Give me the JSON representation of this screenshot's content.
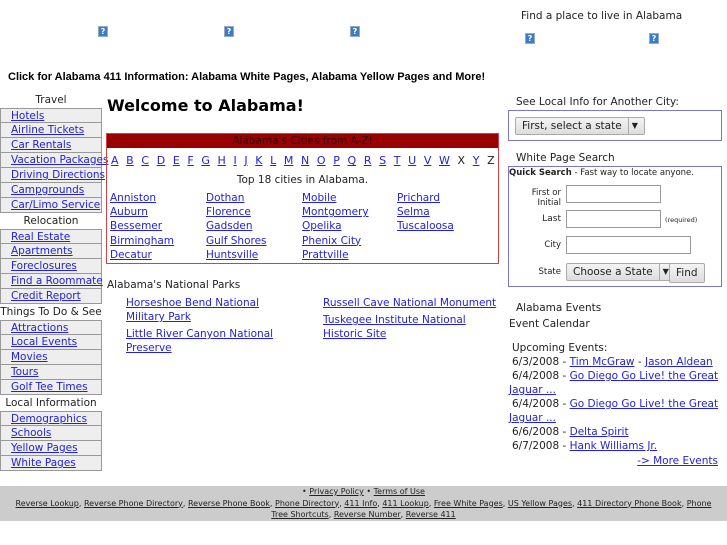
{
  "header": {
    "find_place": "Find a place to live in Alabama",
    "icon": "broken-image-icon",
    "info_line": "Click for Alabama 411 Information: Alabama White Pages, Alabama Yellow Pages and More!"
  },
  "sidebar": [
    {
      "title": "Travel",
      "items": [
        "Hotels",
        "Airline Tickets",
        "Car Rentals",
        "Vacation Packages",
        "Driving Directions",
        "Campgrounds",
        "Car/Limo Service"
      ]
    },
    {
      "title": "Relocation",
      "items": [
        "Real Estate",
        "Apartments",
        "Foreclosures",
        "Find a Roommate",
        "Credit Report"
      ]
    },
    {
      "title": "Things To Do & See",
      "items": [
        "Attractions",
        "Local Events",
        "Movies",
        "Tours",
        "Golf Tee Times"
      ]
    },
    {
      "title": "Local Information",
      "items": [
        "Demographics",
        "Schools",
        "Yellow Pages",
        "White Pages"
      ]
    }
  ],
  "main": {
    "title": "Welcome to Alabama!",
    "cities_header": "Alabama's Cities from A-Z!",
    "letters": [
      "A",
      "B",
      "C",
      "D",
      "E",
      "F",
      "G",
      "H",
      "I",
      "J",
      "K",
      "L",
      "M",
      "N",
      "O",
      "P",
      "Q",
      "R",
      "S",
      "T",
      "U",
      "V",
      "W",
      "X",
      "Y",
      "Z"
    ],
    "unlinked_letters": [
      "X",
      "Z"
    ],
    "top_cities_label": "Top 18 cities in Alabama.",
    "city_columns": [
      [
        "Anniston",
        "Auburn",
        "Bessemer",
        "Birmingham",
        "Decatur"
      ],
      [
        "Dothan",
        "Florence",
        "Gadsden",
        "Gulf Shores",
        "Huntsville"
      ],
      [
        "Mobile",
        "Montgomery",
        "Opelika",
        "Phenix City",
        "Prattville"
      ],
      [
        "Prichard",
        "Selma",
        "Tuscaloosa"
      ]
    ],
    "parks_title": "Alabama's National Parks",
    "parks": [
      "Horseshoe Bend National Military Park",
      "Little River Canyon National Preserve",
      "Russell Cave National Monument",
      "Tuskegee Institute National Historic Site"
    ],
    "header_color": "#990000"
  },
  "right": {
    "local_info_title": "See Local Info for Another City:",
    "state_select": "First, select a state",
    "wp_title": "White Page Search",
    "quick_search": "Quick Search",
    "quick_desc": " - Fast way to locate anyone.",
    "first_label": "First or Initial",
    "last_label": "Last",
    "required": "(required)",
    "city_label": "City",
    "state_label": "State",
    "state_choose": "Choose a State",
    "find": "Find",
    "events_title": "Alabama Events",
    "calendar": "Event Calendar",
    "upcoming": "Upcoming Events:",
    "events": [
      {
        "date": "6/3/2008 - ",
        "links": [
          "Tim McGraw",
          "Jason Aldean"
        ]
      },
      {
        "date": "6/4/2008 - ",
        "links": [
          "Go Diego Go Live! the Great Jaguar ..."
        ]
      },
      {
        "date": "6/4/2008 - ",
        "links": [
          "Go Diego Go Live! the Great Jaguar ..."
        ]
      },
      {
        "date": "6/6/2008 - ",
        "links": [
          "Delta Spirit"
        ]
      },
      {
        "date": "6/7/2008 - ",
        "links": [
          "Hank Williams Jr."
        ]
      }
    ],
    "more_events": "-> More Events"
  },
  "footer": {
    "top_links": [
      "Privacy Policy",
      "Terms of Use"
    ],
    "links": [
      "Reverse Lookup",
      "Reverse Phone Directory",
      "Reverse Phone Book",
      "Phone Directory",
      "411 Info",
      "411 Lookup",
      "Free White Pages",
      "US Yellow Pages",
      "411 Directory Phone Book",
      "Phone Tree Shortcuts",
      "Reverse Number",
      "Reverse 411"
    ]
  }
}
